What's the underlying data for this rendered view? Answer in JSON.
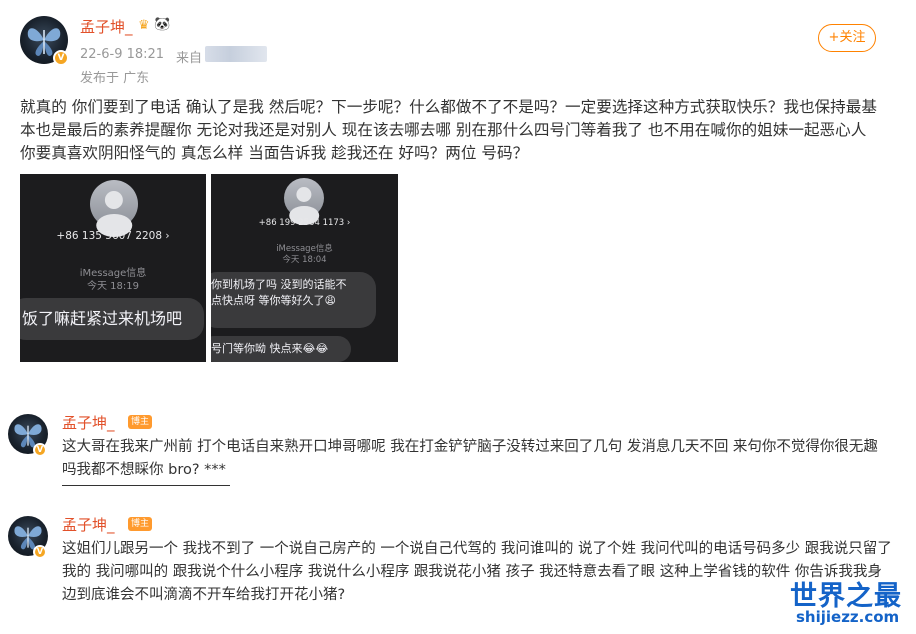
{
  "post": {
    "author": "孟子坤_",
    "time": "22-6-9 18:21",
    "source_label": "来自",
    "location": "发布于 广东",
    "follow_label": "+关注",
    "text": "就真的 你们要到了电话 确认了是我 然后呢？下一步呢？什么都做不了不是吗？一定要选择这种方式获取快乐？我也保持最基本也是最后的素养提醒你 无论对我还是对别人 现在该去哪去哪 别在那什么四号门等着我了 也不用在喊你的姐妹一起恶心人 你要真喜欢阴阳怪气的 真怎么样 当面告诉我 趁我还在 好吗？两位 号码？"
  },
  "screenshots": [
    {
      "phone": "+86 135 5607 2208 ›",
      "service": "iMessage信息",
      "time": "今天 18:19",
      "message": "饭了嘛赶紧过来机场吧"
    },
    {
      "phone": "+86 199 2564 1173 ›",
      "service": "iMessage信息",
      "time": "今天 18:04",
      "message_1_line_1": "你到机场了吗 没到的话能不",
      "message_1_line_2": "点快点呀 等你等好久了😩",
      "message_2": "号门等你呦 快点来😂😂"
    }
  ],
  "comments": [
    {
      "author": "孟子坤_",
      "badge": "博主",
      "text": "这大哥在我来广州前 打个电话自来熟开口坤哥哪呢 我在打金铲铲脑子没转过来回了几句 发消息几天不回 来句你不觉得你很无趣吗我都不想睬你 bro? ***"
    },
    {
      "author": "孟子坤_",
      "badge": "博主",
      "text": "这姐们儿跟另一个 我找不到了 一个说自己房产的 一个说自己代驾的 我问谁叫的 说了个姓 我问代叫的电话号码多少 跟我说只留了我的 我问哪叫的 跟我说个什么小程序 我说什么小程序 跟我说花小猪 孩子 我还特意去看了眼 这种上学省钱的软件 你告诉我我身边到底谁会不叫滴滴不开车给我打开花小猪?"
    }
  ],
  "watermark": {
    "title": "世界之最",
    "url": "shijiezz.com"
  },
  "colors": {
    "username": "#e2512a",
    "follow": "#ff8200",
    "meta": "#999999",
    "watermark": "#1463c8"
  }
}
